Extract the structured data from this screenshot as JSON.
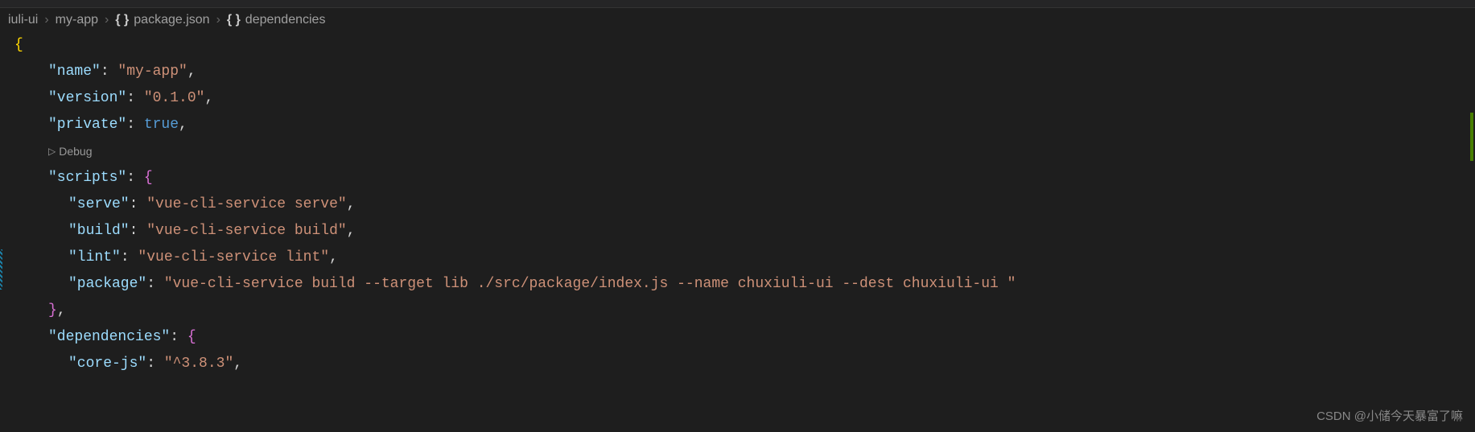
{
  "breadcrumb": {
    "items": [
      {
        "label": "iuli-ui",
        "icon": null
      },
      {
        "label": "my-app",
        "icon": null
      },
      {
        "label": "package.json",
        "icon": "braces"
      },
      {
        "label": "dependencies",
        "icon": "braces"
      }
    ]
  },
  "codelens": {
    "debug": "Debug"
  },
  "json": {
    "name_key": "\"name\"",
    "name_val": "\"my-app\"",
    "version_key": "\"version\"",
    "version_val": "\"0.1.0\"",
    "private_key": "\"private\"",
    "private_val": "true",
    "scripts_key": "\"scripts\"",
    "serve_key": "\"serve\"",
    "serve_val": "\"vue-cli-service serve\"",
    "build_key": "\"build\"",
    "build_val": "\"vue-cli-service build\"",
    "lint_key": "\"lint\"",
    "lint_val": "\"vue-cli-service lint\"",
    "package_key": "\"package\"",
    "package_val": "\"vue-cli-service build --target lib ./src/package/index.js --name chuxiuli-ui --dest chuxiuli-ui \"",
    "deps_key": "\"dependencies\"",
    "corejs_key": "\"core-js\"",
    "corejs_val": "\"^3.8.3\""
  },
  "watermark": "CSDN @小储今天暴富了嘛"
}
